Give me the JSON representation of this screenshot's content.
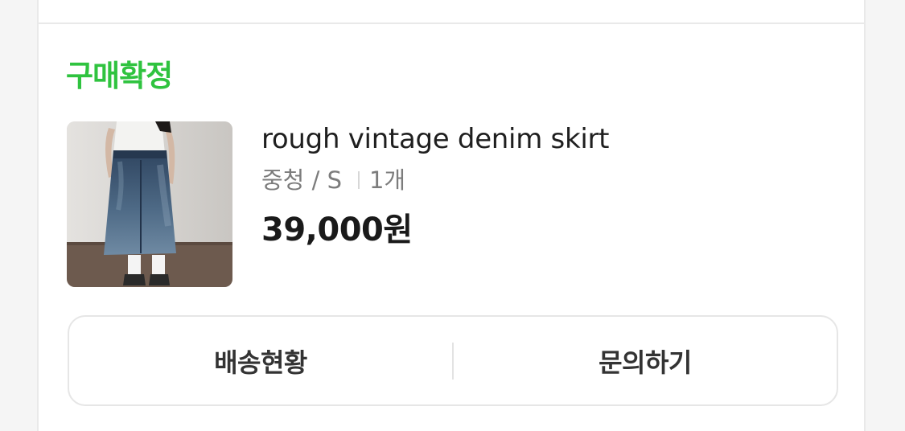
{
  "order": {
    "status_label": "구매확정",
    "status_color": "#2fc33f"
  },
  "product": {
    "name": "rough vintage denim skirt",
    "option": "중청 / S",
    "quantity": "1개",
    "price": "39,000원"
  },
  "actions": {
    "shipping_label": "배송현황",
    "inquiry_label": "문의하기"
  }
}
